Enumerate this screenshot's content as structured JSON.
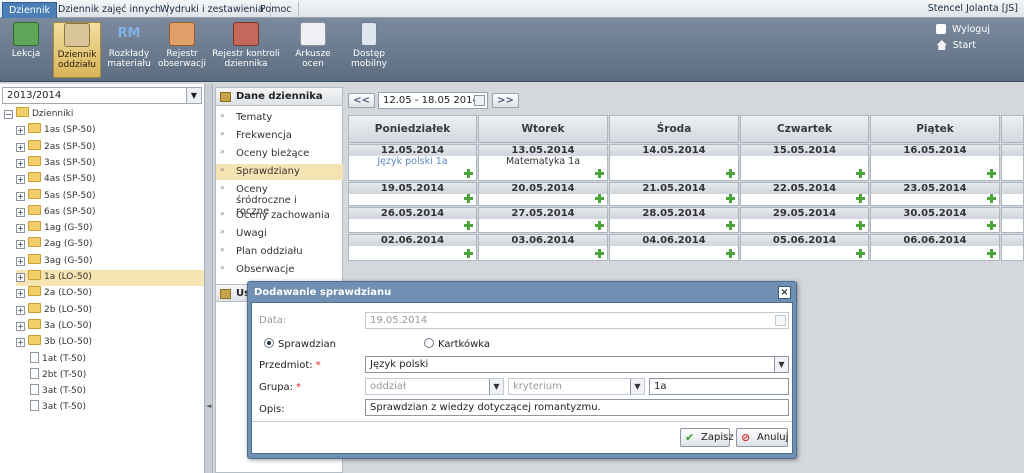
{
  "topbar": {
    "tabs": [
      "Dziennik",
      "Dziennik zajęć innych",
      "Wydruki i zestawienia",
      "Pomoc"
    ],
    "user": "Stencel Jolanta [JS]"
  },
  "ribbon": {
    "buttons": [
      {
        "label": "Lekcja",
        "icon": "lesson-icon"
      },
      {
        "label": "Dziennik oddziału",
        "icon": "class-register-icon"
      },
      {
        "label": "Rozkłady materiału",
        "icon": "syllabus-icon"
      },
      {
        "label": "Rejestr obserwacji",
        "icon": "observation-register-icon"
      },
      {
        "label": "Rejestr kontroli dziennika",
        "icon": "control-register-icon"
      },
      {
        "label": "Arkusze ocen",
        "icon": "grade-sheets-icon"
      },
      {
        "label": "Dostęp mobilny",
        "icon": "mobile-access-icon"
      }
    ],
    "logout": "Wyloguj",
    "start": "Start"
  },
  "left": {
    "year": "2013/2014",
    "root": "Dzienniki",
    "folders": [
      "1as (SP-50)",
      "2as (SP-50)",
      "3as (SP-50)",
      "4as (SP-50)",
      "5as (SP-50)",
      "6as (SP-50)",
      "1ag (G-50)",
      "2ag (G-50)",
      "3ag (G-50)",
      "1a (LO-50)",
      "2a (LO-50)",
      "2b (LO-50)",
      "3a (LO-50)",
      "3b (LO-50)"
    ],
    "selected": "1a (LO-50)",
    "docs": [
      "1at (T-50)",
      "2bt (T-50)",
      "3at (T-50)",
      "3at (T-50)"
    ]
  },
  "menu": {
    "header": "Dane dziennika",
    "items": [
      "Tematy",
      "Frekwencja",
      "Oceny bieżące",
      "Sprawdziany",
      "Oceny śródroczne i roczne",
      "Oceny zachowania",
      "Uwagi",
      "Plan oddziału",
      "Obserwacje"
    ],
    "active": "Sprawdziany",
    "header2": "Us"
  },
  "calendar": {
    "range": "12.05 - 18.05 2014",
    "prev": "<<",
    "next": ">>",
    "days": [
      "Poniedziałek",
      "Wtorek",
      "Środa",
      "Czwartek",
      "Piątek"
    ],
    "weeks": [
      {
        "dates": [
          "12.05.2014",
          "13.05.2014",
          "14.05.2014",
          "15.05.2014",
          "16.05.2014"
        ],
        "events": [
          "Język polski 1a",
          "Matematyka 1a",
          "",
          "",
          ""
        ]
      },
      {
        "dates": [
          "19.05.2014",
          "20.05.2014",
          "21.05.2014",
          "22.05.2014",
          "23.05.2014"
        ],
        "events": [
          "",
          "",
          "",
          "",
          ""
        ]
      },
      {
        "dates": [
          "26.05.2014",
          "27.05.2014",
          "28.05.2014",
          "29.05.2014",
          "30.05.2014"
        ],
        "events": [
          "",
          "",
          "",
          "",
          ""
        ]
      },
      {
        "dates": [
          "02.06.2014",
          "03.06.2014",
          "04.06.2014",
          "05.06.2014",
          "06.06.2014"
        ],
        "events": [
          "",
          "",
          "",
          "",
          ""
        ]
      }
    ]
  },
  "dialog": {
    "title": "Dodawanie sprawdzianu",
    "close": "×",
    "date_label": "Data:",
    "date_value": "19.05.2014",
    "radio_test": "Sprawdzian",
    "radio_quiz": "Kartkówka",
    "subject_label": "Przedmiot:",
    "subject_value": "Język polski",
    "group_label": "Grupa:",
    "group_value": "oddział",
    "criterion_value": "kryterium",
    "class_value": "1a",
    "desc_label": "Opis:",
    "desc_value": "Sprawdzian z wiedzy dotyczącej romantyzmu.",
    "required": "*",
    "save": "Zapisz",
    "cancel": "Anuluj"
  }
}
